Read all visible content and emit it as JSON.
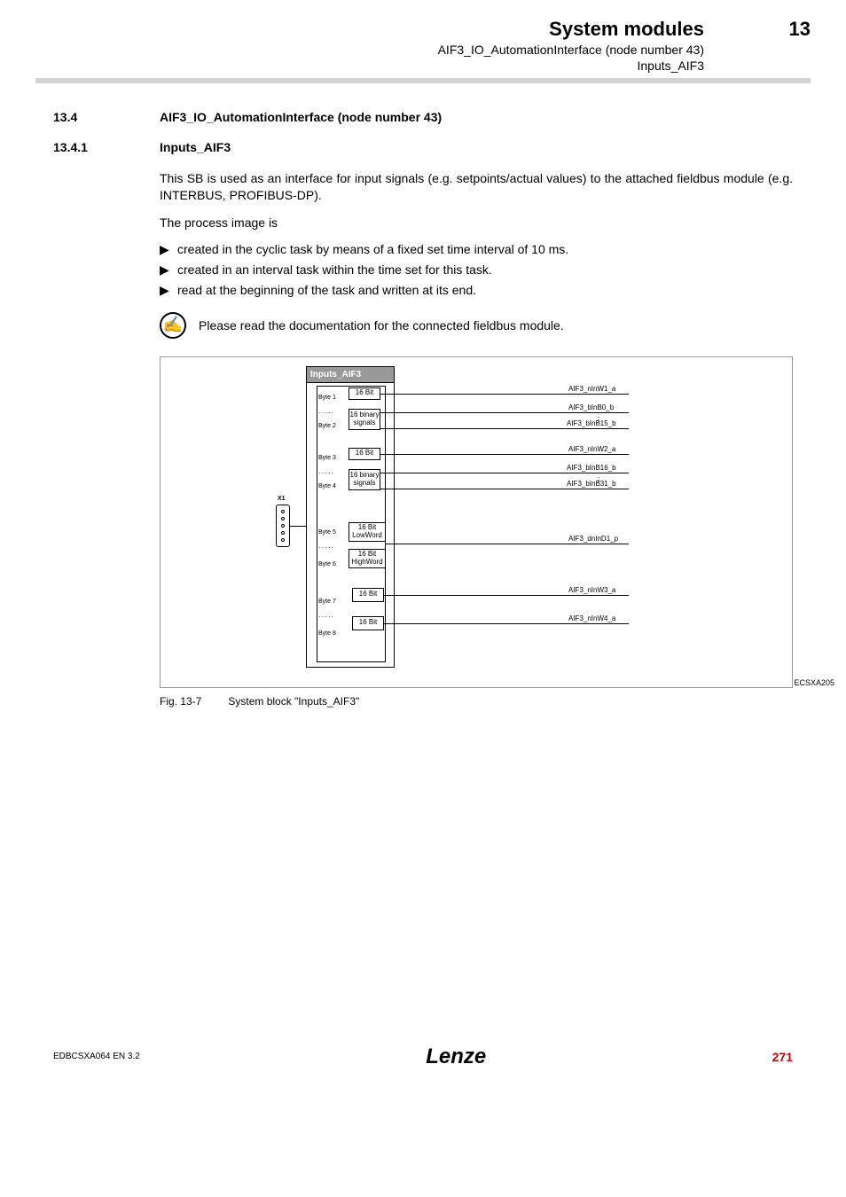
{
  "header": {
    "title": "System modules",
    "sub1": "AIF3_IO_AutomationInterface (node number 43)",
    "sub2": "Inputs_AIF3",
    "chapter": "13"
  },
  "sec1": {
    "num": "13.4",
    "title": "AIF3_IO_AutomationInterface (node number 43)"
  },
  "sec2": {
    "num": "13.4.1",
    "title": "Inputs_AIF3"
  },
  "para1": "This SB is used as an interface for input signals (e.g. setpoints/actual values) to the attached fieldbus module (e.g. INTERBUS, PROFIBUS-DP).",
  "para2": "The process image is",
  "bullets": [
    "created in the cyclic task by means of a fixed set time interval of 10 ms.",
    "created in an interval task within the time set for this task.",
    "read at the beginning of the task and written at its end."
  ],
  "tip": "Please read the documentation for the connected fieldbus module.",
  "diagram": {
    "title": "Inputs_AIF3",
    "x1": "X1",
    "bytes": [
      "Byte 1",
      "Byte 2",
      "Byte 3",
      "Byte 4",
      "Byte 5",
      "Byte 6",
      "Byte 7",
      "Byte 8"
    ],
    "boxes": {
      "b16_1": "16 Bit",
      "bin1": "16 binary signals",
      "b16_2": "16 Bit",
      "bin2": "16 binary signals",
      "low": "16 Bit LowWord",
      "high": "16 Bit HighWord",
      "b16_3": "16 Bit",
      "b16_4": "16 Bit"
    },
    "signals": {
      "w1": "AIF3_nInW1_a",
      "b0": "AIF3_bInB0_b",
      "b15": "AIF3_bInB15_b",
      "w2": "AIF3_nInW2_a",
      "b16": "AIF3_bInB16_b",
      "b31": "AIF3_bInB31_b",
      "d1": "AIF3_dnInD1_p",
      "w3": "AIF3_nInW3_a",
      "w4": "AIF3_nInW4_a",
      "vdots": "⋮"
    },
    "ecs": "ECSXA205"
  },
  "fig": {
    "num": "Fig. 13-7",
    "caption": "System block \"Inputs_AIF3\""
  },
  "footer": {
    "left": "EDBCSXA064 EN 3.2",
    "logo": "Lenze",
    "page": "271"
  }
}
